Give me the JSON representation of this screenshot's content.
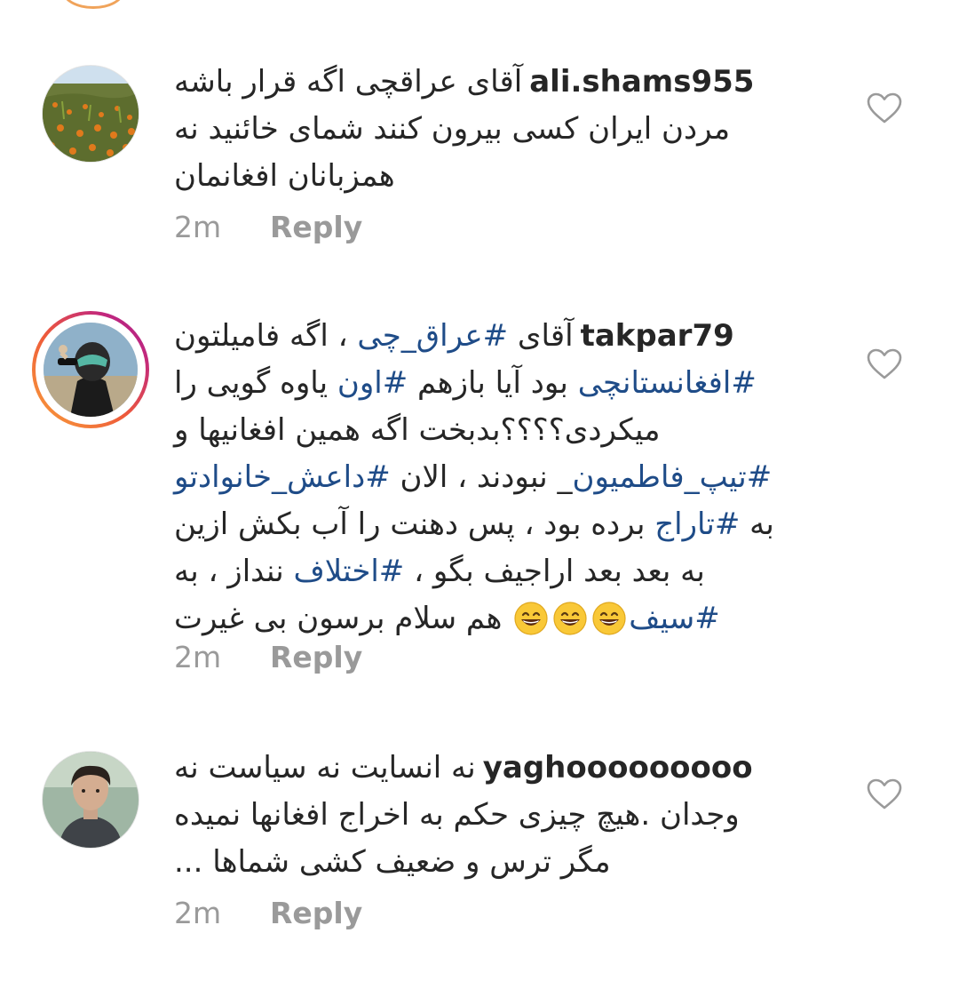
{
  "comments": [
    {
      "username": "ali.shams955",
      "text": "آقای عراقچی اگه قرار باشه مردن ایران کسی بیرون کنند شمای خائنید نه همزبانان افغانمان",
      "time": "2m",
      "reply_label": "Reply"
    },
    {
      "username": "takpar79",
      "segments": [
        {
          "t": "آقای "
        },
        {
          "t": "#عراق_چی",
          "tag": true
        },
        {
          "t": " ، اگه فامیلتون "
        },
        {
          "t": "#افغانستانچی",
          "tag": true
        },
        {
          "t": " بود آیا بازهم "
        },
        {
          "t": "#اون",
          "tag": true
        },
        {
          "t": " یاوه گویی را میکردی؟؟؟؟بدبخت اگه همین افغانیها و "
        },
        {
          "t": "#تیپ_فاطمیون",
          "tag": true
        },
        {
          "t": "_ نبودند ، الان "
        },
        {
          "t": "#داعش_خانوادتو",
          "tag": true
        },
        {
          "t": " به "
        },
        {
          "t": "#تاراج",
          "tag": true
        },
        {
          "t": " برده بود ، پس دهنت را آب بکش ازین به بعد بعد اراجیف بگو ، "
        },
        {
          "t": "#اختلاف",
          "tag": true
        },
        {
          "t": " ننداز ، به "
        },
        {
          "t": "#سیف",
          "tag": true
        },
        {
          "t": " هم سلام برسون بی غیرت"
        }
      ],
      "emoji_count": 3,
      "time": "2m",
      "reply_label": "Reply"
    },
    {
      "username": "yaghooooooooo",
      "text": "نه انسایت نه سیاست نه وجدان .هیچ چیزی حکم به اخراج افغانها نمیده مگر ترس و ضعیف کشی شماها ...",
      "time": "2m",
      "reply_label": "Reply"
    }
  ],
  "colors": {
    "hashtag": "#1f4c88",
    "meta": "#9a9a9a",
    "story_ring": [
      "#f9a23b",
      "#ee5a3a",
      "#c1277e"
    ]
  },
  "icons": {
    "like": "heart-outline-icon",
    "emoji": "grinning-face-icon"
  }
}
